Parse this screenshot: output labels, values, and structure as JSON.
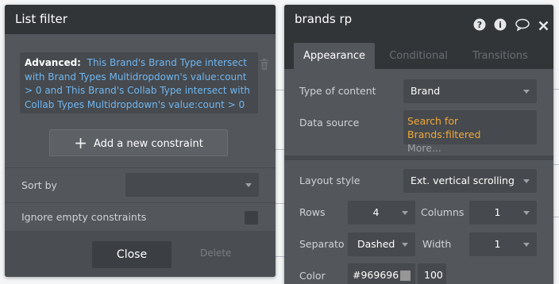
{
  "list_filter": {
    "title": "List filter",
    "constraint_key": "Advanced:",
    "constraint_value": "This Brand's Brand Type intersect with Brand Types Multidropdown's value:count > 0 and This Brand's Collab Type intersect with Collab Types Multidropdown's value:count > 0",
    "add_constraint_label": "Add a new constraint",
    "sort_by_label": "Sort by",
    "sort_by_value": "",
    "ignore_empty_label": "Ignore empty constraints",
    "ignore_empty_checked": false,
    "close_label": "Close",
    "delete_label": "Delete"
  },
  "property_editor": {
    "title": "brands rp",
    "icons": [
      "help-icon",
      "info-icon",
      "comment-icon",
      "close-icon"
    ],
    "tabs": [
      {
        "label": "Appearance",
        "active": true
      },
      {
        "label": "Conditional",
        "active": false
      },
      {
        "label": "Transitions",
        "active": false
      }
    ],
    "type_of_content_label": "Type of content",
    "type_of_content_value": "Brand",
    "data_source_label": "Data source",
    "data_source_value": "Search for Brands:filtered",
    "data_source_more": "More...",
    "layout_style_label": "Layout style",
    "layout_style_value": "Ext. vertical scrolling",
    "rows_label": "Rows",
    "rows_value": "4",
    "columns_label": "Columns",
    "columns_value": "1",
    "separator_label": "Separato",
    "separator_value": "Dashed",
    "width_label": "Width",
    "width_value": "1",
    "color_label": "Color",
    "color_value": "#969696",
    "opacity_value": "100"
  },
  "colors": {
    "panel_bg": "#53575c",
    "titlebar_bg": "#323538",
    "field_bg": "#46494d",
    "link_blue": "#6fb7f2",
    "dynamic_orange": "#f0a93a",
    "separator_swatch": "#969696"
  }
}
